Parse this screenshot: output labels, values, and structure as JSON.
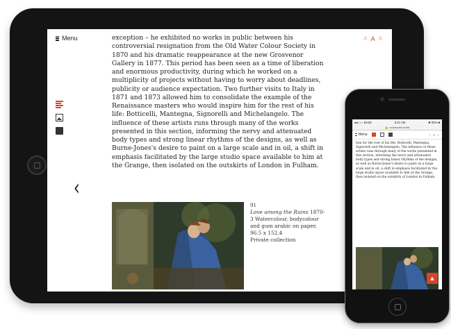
{
  "tablet": {
    "menu_label": "Menu",
    "font_sizes": [
      "A",
      "A",
      "A"
    ],
    "article_text": "exception – he exhibited no works in public between his controversial resignation from the Old Water Colour Society in 1870 and his dramatic reappearance at the new Grosvenor Gallery in 1877. This period has been seen as a time of liberation and enormous productivity, during which he worked on a multiplicity of projects without having to worry about deadlines, publicity or audience expectation. Two further visits to Italy in 1871 and 1873 allowed him to consolidate the example of the Renaissance masters who would inspire him for the rest of his life: Botticelli, Mantegna, Signorelli and Michelangelo. The influence of these artists runs through many of the works presented in this section, informing the nervy and attenuated body types and strong linear rhythms of the designs, as well as Burne-Jones's desire to paint on a large scale and in oil, a shift in emphasis facilitated by the large studio space available to him at the Grange, then isolated on the outskirts of London in Fulham.",
    "caption": {
      "number": "91",
      "title": "Love among the Ruins",
      "details": "1870-3 Watercolour, bodycolour and gum arabic on paper, 96.5 x 152.4",
      "collection": "Private collection"
    },
    "side_icons": [
      "text-icon",
      "image-icon",
      "book-icon"
    ],
    "back_icon": "chevron-left-icon"
  },
  "phone": {
    "status_carrier": "●●○○○ BASE",
    "status_time": "9:21 AM",
    "status_battery": "✱ 93% ■",
    "url": "🔒 rocabooks.world",
    "menu_label": "Menu",
    "font_sizes": [
      "A",
      "A",
      "A"
    ],
    "article_text": "him for the rest of his life: Botticelli, Mantegna, Signorelli and Michelangelo. The influence of these artists runs through many of the works presented in this section, informing the nervy and attenuated body types and strong linear rhythms of the designs, as well as Burne-Jones's desire to paint on a large scale and in oil, a shift in emphasis facilitated by the large studio space available to him at the Grange, then isolated on the outskirts of London in Fulham.",
    "scroll_top_icon": "▲"
  },
  "colors": {
    "accent": "#d9432b",
    "accent_light": "#e7a79b",
    "device_body": "#141414",
    "text": "#222222"
  }
}
